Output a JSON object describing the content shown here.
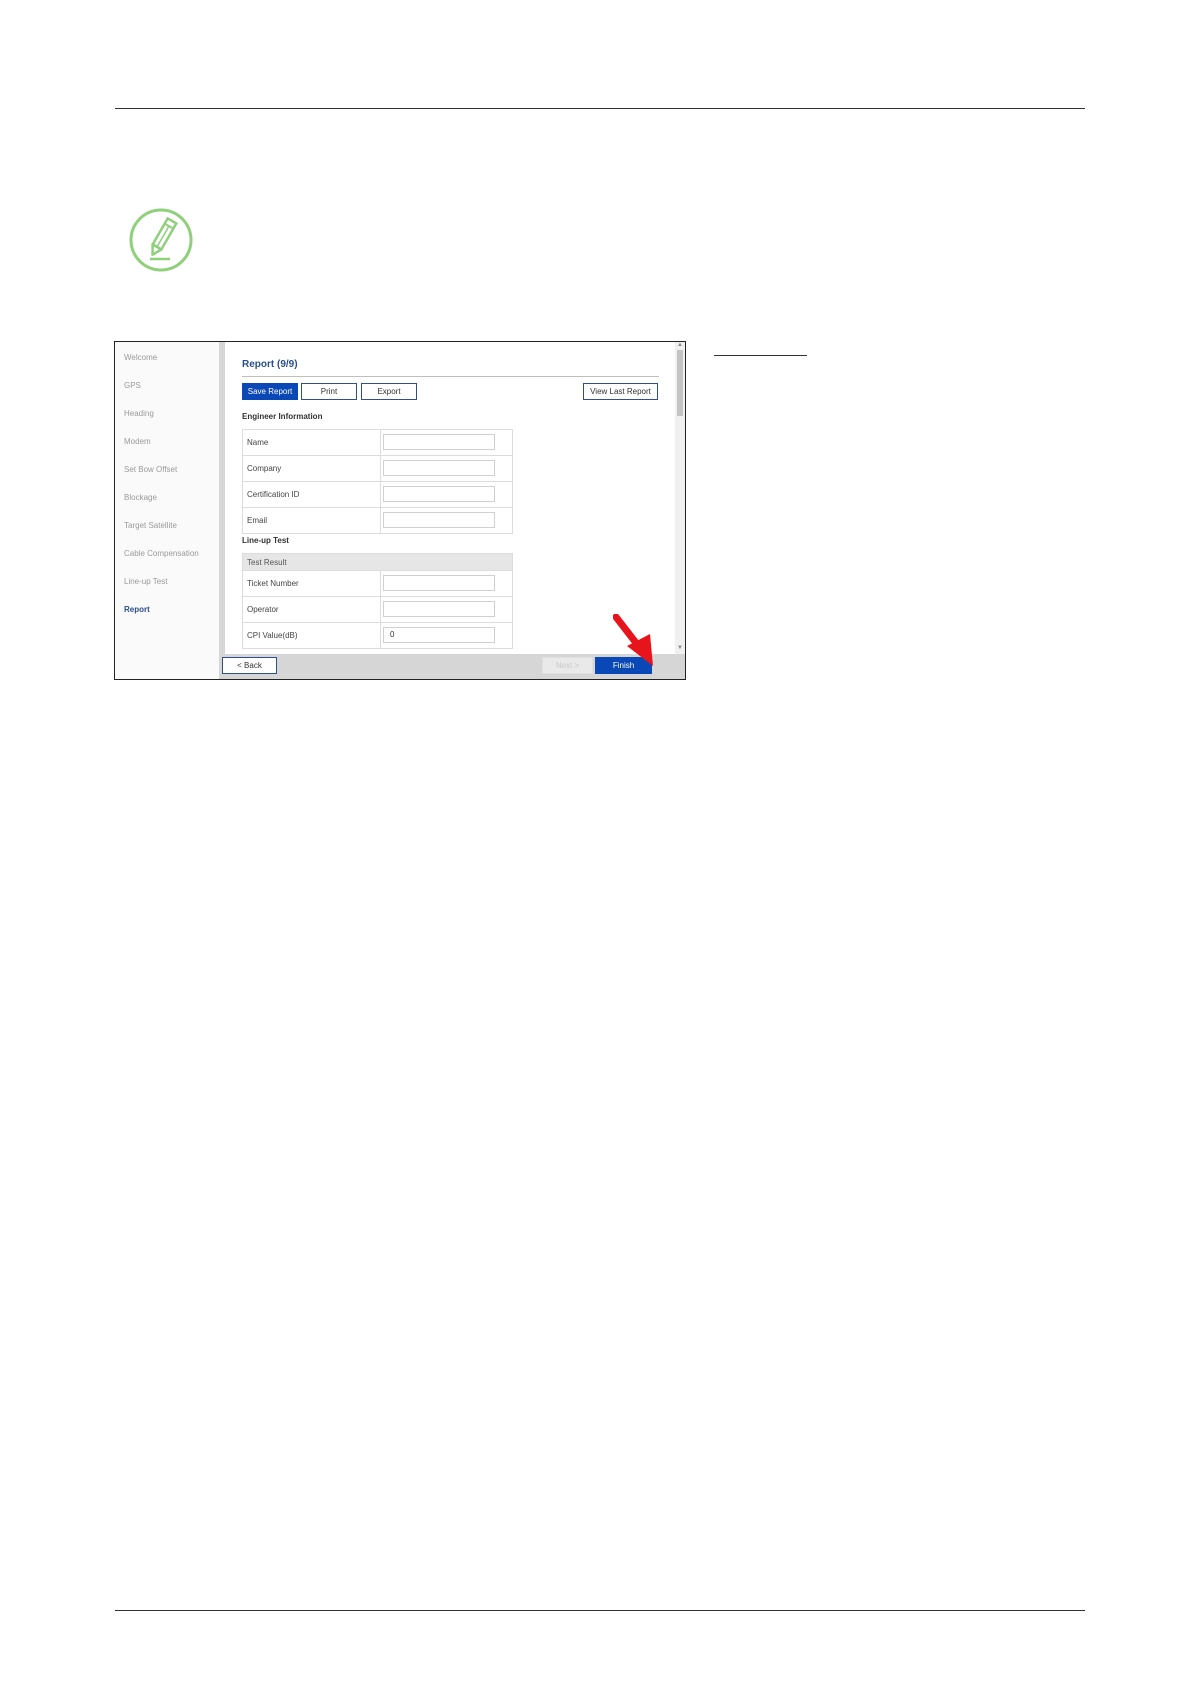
{
  "wizard": {
    "sidebar": {
      "items": [
        {
          "label": "Welcome"
        },
        {
          "label": "GPS"
        },
        {
          "label": "Heading"
        },
        {
          "label": "Modem"
        },
        {
          "label": "Set Bow Offset"
        },
        {
          "label": "Blockage"
        },
        {
          "label": "Target Satellite"
        },
        {
          "label": "Cable Compensation"
        },
        {
          "label": "Line-up Test"
        },
        {
          "label": "Report",
          "active": true
        }
      ]
    },
    "page_title": "Report (9/9)",
    "toolbar": {
      "save_label": "Save Report",
      "print_label": "Print",
      "export_label": "Export",
      "view_last_label": "View Last Report"
    },
    "engineer_section": {
      "title": "Engineer Information",
      "rows": [
        {
          "label": "Name",
          "value": ""
        },
        {
          "label": "Company",
          "value": ""
        },
        {
          "label": "Certification ID",
          "value": ""
        },
        {
          "label": "Email",
          "value": ""
        }
      ]
    },
    "lineup_section": {
      "title": "Line-up Test",
      "group_header": "Test Result",
      "rows": [
        {
          "label": "Ticket Number",
          "value": ""
        },
        {
          "label": "Operator",
          "value": ""
        },
        {
          "label": "CPI Value(dB)",
          "value": "0"
        }
      ]
    },
    "footer": {
      "back_label": "< Back",
      "next_label": "Next >",
      "finish_label": "Finish"
    }
  },
  "colors": {
    "accent": "#0a48b8",
    "title_blue": "#2a4f8f",
    "note_green": "#8fd07a",
    "arrow_red": "#e8141b"
  }
}
